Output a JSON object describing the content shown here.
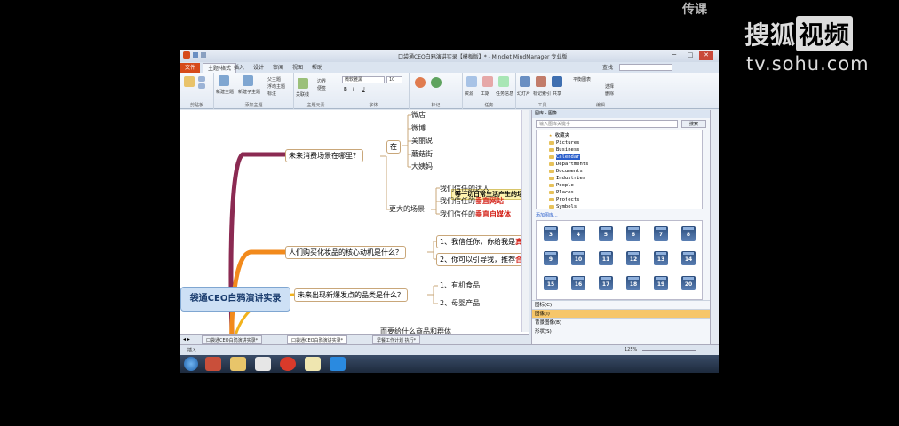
{
  "watermark": {
    "top": "传课",
    "logo_a": "搜狐",
    "logo_b": "视频",
    "url": "tv.sohu.com"
  },
  "window": {
    "title": "口袋通CEO白鸦演讲实录【模板版】* - Mindjet MindManager 专业版",
    "min": "─",
    "max": "□",
    "close": "✕"
  },
  "tabs": [
    "文件",
    "主题/格式",
    "插入",
    "设计",
    "审阅",
    "视图",
    "帮助"
  ],
  "ribbon": {
    "groups": [
      "剪贴板",
      "添加主题",
      "主题元素",
      "字体",
      "标记",
      "任务",
      "工具",
      "编辑"
    ],
    "new_topic": "新建主题",
    "new_subtopic": "新建子主题",
    "parent_topic": "父主题",
    "float_topic": "浮动主题",
    "callout": "标注",
    "relation": "关联线",
    "boundary": "边界",
    "notes": "便签",
    "font_name": "微软雅黑",
    "font_size": "10",
    "find_label": "查找",
    "balance": "平衡图表",
    "select": "选择",
    "delete": "删除",
    "task_info": "任务信息",
    "resources": "资源",
    "duration": "工期",
    "slides": "幻灯片",
    "markers_idx": "标记索引",
    "share": "共享"
  },
  "map": {
    "central": "袋通CEO白鸦演讲实录",
    "branch1": "未来消费场景在哪里？",
    "zai": "在",
    "places": [
      "微店",
      "微博",
      "美丽说",
      "蘑菇街",
      "大姨妈"
    ],
    "callout": "等一切日常生活产生的场",
    "bigger_scene": "更大的场景",
    "trust": [
      "我们信任的达人",
      "我们信任的",
      "垂直网站",
      "我们信任的",
      "垂直自媒体"
    ],
    "branch2": "人们购买化妆品的核心动机是什么？",
    "reason1": "1、我信任你，你给我是",
    "reason1_red": "真品",
    "reason2": "2、你可以引导我，推荐",
    "reason2_red": "合适",
    "branch3": "未来出现新爆发点的品类是什么？",
    "cat1": "1、有机食品",
    "cat2": "2、母婴产品",
    "branch4": "而要给什么商品和群体"
  },
  "sheet_tabs": [
    "口袋通CEO白鸦演讲实录*",
    "口袋通CEO白鸦演讲实录*",
    "早餐工作计划 执行*"
  ],
  "status": {
    "zoom": "125%",
    "left": "插入"
  },
  "taskpane": {
    "title": "图库 - 图像",
    "search_placeholder": "输入图库关键字",
    "search_btn": "搜索",
    "tree": [
      "收藏夹",
      "Pictures",
      "Business",
      "Calendar",
      "Departments",
      "Documents",
      "Industries",
      "People",
      "Places",
      "Projects",
      "Symbols"
    ],
    "add_lib": "添加图库...",
    "calendar_nums": [
      "3",
      "4",
      "5",
      "6",
      "7",
      "8",
      "9",
      "10",
      "11",
      "12",
      "13",
      "14",
      "15",
      "16",
      "17",
      "18",
      "19",
      "20"
    ],
    "categories": [
      "图标(C)",
      "图像(I)",
      "背景图像(B)",
      "形状(S)"
    ]
  }
}
